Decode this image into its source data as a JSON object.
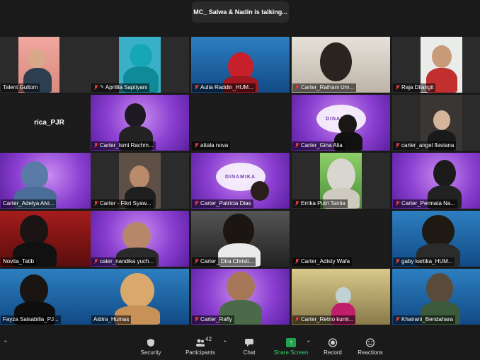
{
  "header": {
    "speaker_text": "MC_ Salwa & Nadin is talking..."
  },
  "tiles": [
    {
      "name": "Talent Gultom",
      "muted": false,
      "pinned": false
    },
    {
      "name": "Aprillia Saptiyani",
      "muted": true,
      "pinned": true
    },
    {
      "name": "Aulia Raddin_HUM...",
      "muted": true,
      "pinned": false
    },
    {
      "name": "Carter_Raihani Um...",
      "muted": true,
      "pinned": false
    },
    {
      "name": "Raja Dilangit",
      "muted": true,
      "pinned": false
    },
    {
      "name": "rica_PJR",
      "muted": false,
      "pinned": false
    },
    {
      "name": "Carter_Ismi Rachm...",
      "muted": true,
      "pinned": false
    },
    {
      "name": "attala nova",
      "muted": true,
      "pinned": false
    },
    {
      "name": "Carter_Gina Alia",
      "muted": true,
      "pinned": false
    },
    {
      "name": "carter_angel flaviana",
      "muted": true,
      "pinned": false
    },
    {
      "name": "Carter_Adelya Alvi...",
      "muted": false,
      "pinned": false
    },
    {
      "name": "Carter - Fikri Syaw...",
      "muted": true,
      "pinned": false
    },
    {
      "name": "Carter_Patricia Dias",
      "muted": true,
      "pinned": false
    },
    {
      "name": "Errika Putri Tantia",
      "muted": true,
      "pinned": false
    },
    {
      "name": "Carter_Permata Na...",
      "muted": true,
      "pinned": false
    },
    {
      "name": "Novita_Tatib",
      "muted": false,
      "pinned": false
    },
    {
      "name": "cater_nandika yuch...",
      "muted": true,
      "pinned": false
    },
    {
      "name": "Carter_ Dira Christi...",
      "muted": true,
      "pinned": false
    },
    {
      "name": "Carter_Adisty Wafa",
      "muted": true,
      "pinned": false
    },
    {
      "name": "gaby kartika_HUM...",
      "muted": true,
      "pinned": false
    },
    {
      "name": "Fayza Salsabilla_PJ...",
      "muted": false,
      "pinned": false
    },
    {
      "name": "Aldira_Humas",
      "muted": false,
      "pinned": false
    },
    {
      "name": "Carter_Rafly",
      "muted": true,
      "pinned": false
    },
    {
      "name": "Carter_Retno kurni...",
      "muted": true,
      "pinned": false
    },
    {
      "name": "Khairani_Bendahara",
      "muted": true,
      "pinned": false
    }
  ],
  "background_logo": "DINAMIKA",
  "toolbar": {
    "security": "Security",
    "participants": "Participants",
    "participants_count": "42",
    "chat": "Chat",
    "share": "Share Screen",
    "record": "Record",
    "reactions": "Reactions"
  }
}
